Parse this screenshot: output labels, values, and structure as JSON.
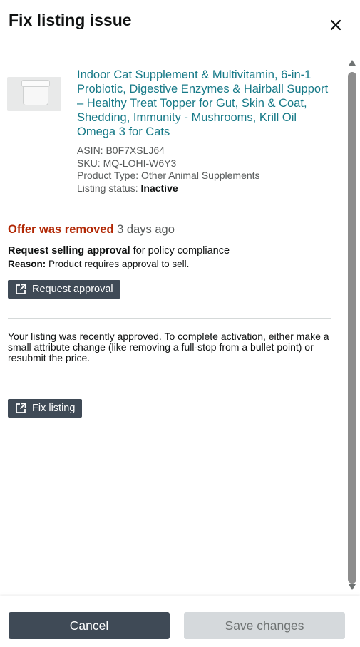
{
  "modal": {
    "title": "Fix listing issue"
  },
  "product": {
    "title": "Indoor Cat Supplement & Multivitamin, 6-in-1 Probiotic, Digestive Enzymes & Hairball Support – Healthy Treat Topper for Gut, Skin & Coat, Shedding, Immunity - Mushrooms, Krill Oil Omega 3 for Cats",
    "asin": "ASIN: B0F7XSLJ64",
    "sku": "SKU: MQ-LOHI-W6Y3",
    "product_type": "Product Type: Other Animal Supplements",
    "listing_status_label": "Listing status: ",
    "listing_status_value": "Inactive"
  },
  "issue": {
    "offer_removed": "Offer was removed",
    "time_ago": "3 days ago",
    "request_bold": "Request selling approval",
    "request_rest": " for policy compliance",
    "reason_label": "Reason:",
    "reason_text": " Product requires approval to sell.",
    "request_button": "Request approval",
    "note": "Your listing was recently approved. To complete activation, either make a small attribute change (like removing a full-stop from a bullet point) or resubmit the price.",
    "fix_button": "Fix listing"
  },
  "footer": {
    "cancel": "Cancel",
    "save": "Save changes"
  },
  "colors": {
    "accent_teal": "#167987",
    "alert_red": "#b12704",
    "dark_button": "#3f4a56",
    "disabled_button": "#d5d9dc"
  }
}
